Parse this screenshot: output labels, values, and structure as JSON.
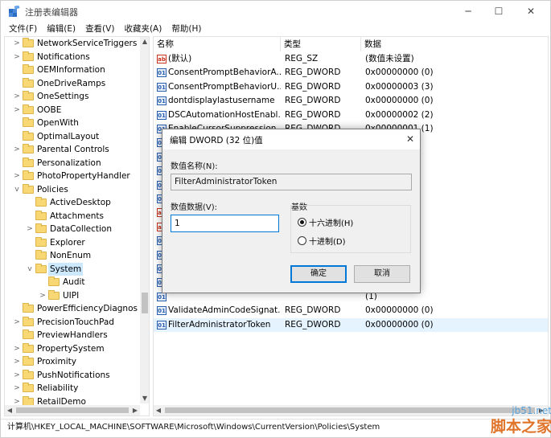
{
  "window": {
    "title": "注册表编辑器",
    "minimize_glyph": "─",
    "maximize_glyph": "☐",
    "close_glyph": "✕"
  },
  "menu": [
    "文件(F)",
    "编辑(E)",
    "查看(V)",
    "收藏夹(A)",
    "帮助(H)"
  ],
  "tree": {
    "items": [
      {
        "label": "NetworkServiceTriggers",
        "level": 0,
        "expander": ">"
      },
      {
        "label": "Notifications",
        "level": 0,
        "expander": ">"
      },
      {
        "label": "OEMInformation",
        "level": 0,
        "expander": ""
      },
      {
        "label": "OneDriveRamps",
        "level": 0,
        "expander": ""
      },
      {
        "label": "OneSettings",
        "level": 0,
        "expander": ">"
      },
      {
        "label": "OOBE",
        "level": 0,
        "expander": ">"
      },
      {
        "label": "OpenWith",
        "level": 0,
        "expander": ""
      },
      {
        "label": "OptimalLayout",
        "level": 0,
        "expander": ""
      },
      {
        "label": "Parental Controls",
        "level": 0,
        "expander": ">"
      },
      {
        "label": "Personalization",
        "level": 0,
        "expander": ""
      },
      {
        "label": "PhotoPropertyHandler",
        "level": 0,
        "expander": ">"
      },
      {
        "label": "Policies",
        "level": 0,
        "expander": "v"
      },
      {
        "label": "ActiveDesktop",
        "level": 1,
        "expander": ""
      },
      {
        "label": "Attachments",
        "level": 1,
        "expander": ""
      },
      {
        "label": "DataCollection",
        "level": 1,
        "expander": ">"
      },
      {
        "label": "Explorer",
        "level": 1,
        "expander": ""
      },
      {
        "label": "NonEnum",
        "level": 1,
        "expander": ""
      },
      {
        "label": "System",
        "level": 1,
        "expander": "v",
        "selected": true
      },
      {
        "label": "Audit",
        "level": 2,
        "expander": ""
      },
      {
        "label": "UIPI",
        "level": 2,
        "expander": ">"
      },
      {
        "label": "PowerEfficiencyDiagnos",
        "level": 0,
        "expander": ""
      },
      {
        "label": "PrecisionTouchPad",
        "level": 0,
        "expander": ">"
      },
      {
        "label": "PreviewHandlers",
        "level": 0,
        "expander": ""
      },
      {
        "label": "PropertySystem",
        "level": 0,
        "expander": ">"
      },
      {
        "label": "Proximity",
        "level": 0,
        "expander": ">"
      },
      {
        "label": "PushNotifications",
        "level": 0,
        "expander": ">"
      },
      {
        "label": "Reliability",
        "level": 0,
        "expander": ">"
      },
      {
        "label": "RetailDemo",
        "level": 0,
        "expander": ">"
      }
    ]
  },
  "list": {
    "headers": {
      "name": "名称",
      "type": "类型",
      "data": "数据"
    },
    "rows": [
      {
        "icon": "ab",
        "kind": "sz",
        "name": "(默认)",
        "type": "REG_SZ",
        "data": "(数值未设置)"
      },
      {
        "icon": "01",
        "kind": "dw",
        "name": "ConsentPromptBehaviorA...",
        "type": "REG_DWORD",
        "data": "0x00000000 (0)"
      },
      {
        "icon": "01",
        "kind": "dw",
        "name": "ConsentPromptBehaviorU...",
        "type": "REG_DWORD",
        "data": "0x00000003 (3)"
      },
      {
        "icon": "01",
        "kind": "dw",
        "name": "dontdisplaylastusername",
        "type": "REG_DWORD",
        "data": "0x00000000 (0)"
      },
      {
        "icon": "01",
        "kind": "dw",
        "name": "DSCAutomationHostEnabl...",
        "type": "REG_DWORD",
        "data": "0x00000002 (2)"
      },
      {
        "icon": "01",
        "kind": "dw",
        "name": "EnableCursorSuppression",
        "type": "REG_DWORD",
        "data": "0x00000001 (1)"
      },
      {
        "icon": "01",
        "kind": "dw",
        "name": "",
        "type": "",
        "data": "(0)"
      },
      {
        "icon": "01",
        "kind": "dw",
        "name": "",
        "type": "",
        "data": "(0)"
      },
      {
        "icon": "01",
        "kind": "dw",
        "name": "",
        "type": "",
        "data": "(1)"
      },
      {
        "icon": "01",
        "kind": "dw",
        "name": "",
        "type": "",
        "data": "(0)"
      },
      {
        "icon": "01",
        "kind": "dw",
        "name": "",
        "type": "",
        "data": "(1)"
      },
      {
        "icon": "ab",
        "kind": "sz",
        "name": "",
        "type": "",
        "data": ""
      },
      {
        "icon": "ab",
        "kind": "sz",
        "name": "",
        "type": "",
        "data": ""
      },
      {
        "icon": "01",
        "kind": "dw",
        "name": "",
        "type": "",
        "data": "(0)"
      },
      {
        "icon": "01",
        "kind": "dw",
        "name": "",
        "type": "",
        "data": "(1)"
      },
      {
        "icon": "01",
        "kind": "dw",
        "name": "",
        "type": "",
        "data": "(1)"
      },
      {
        "icon": "01",
        "kind": "dw",
        "name": "",
        "type": "",
        "data": "(0)"
      },
      {
        "icon": "01",
        "kind": "dw",
        "name": "",
        "type": "",
        "data": "(1)"
      },
      {
        "icon": "01",
        "kind": "dw",
        "name": "ValidateAdminCodeSignat...",
        "type": "REG_DWORD",
        "data": "0x00000000 (0)"
      },
      {
        "icon": "01",
        "kind": "dw",
        "name": "FilterAdministratorToken",
        "type": "REG_DWORD",
        "data": "0x00000000 (0)",
        "selected": true
      }
    ]
  },
  "statusbar": {
    "path": "计算机\\HKEY_LOCAL_MACHINE\\SOFTWARE\\Microsoft\\Windows\\CurrentVersion\\Policies\\System"
  },
  "dialog": {
    "title": "编辑 DWORD (32 位)值",
    "close_glyph": "✕",
    "value_name_label": "数值名称(N):",
    "value_name": "FilterAdministratorToken",
    "value_data_label": "数值数据(V):",
    "value_data": "1",
    "base_label": "基数",
    "radio_hex": "十六进制(H)",
    "radio_dec": "十进制(D)",
    "ok_label": "确定",
    "cancel_label": "取消"
  },
  "watermark": {
    "site": "jb51.net",
    "brand": "脚本之家"
  }
}
